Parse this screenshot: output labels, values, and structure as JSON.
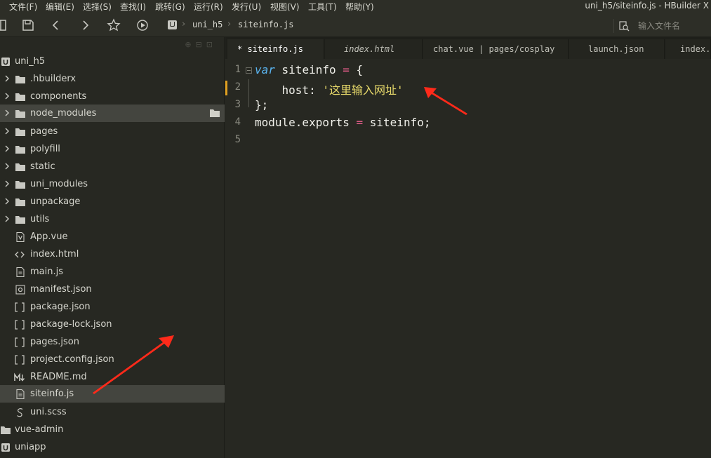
{
  "menu": [
    "文件(F)",
    "编辑(E)",
    "选择(S)",
    "查找(I)",
    "跳转(G)",
    "运行(R)",
    "发行(U)",
    "视图(V)",
    "工具(T)",
    "帮助(Y)"
  ],
  "window_title": "uni_h5/siteinfo.js - HBuilder X",
  "toolbar": {
    "breadcrumb_project": "uni_h5",
    "breadcrumb_file": "siteinfo.js",
    "search_placeholder": "输入文件名"
  },
  "tree": [
    {
      "label": "uni_h5",
      "kind": "project"
    },
    {
      "label": ".hbuilderx",
      "kind": "folder"
    },
    {
      "label": "components",
      "kind": "folder"
    },
    {
      "label": "node_modules",
      "kind": "folder"
    },
    {
      "label": "pages",
      "kind": "folder"
    },
    {
      "label": "polyfill",
      "kind": "folder"
    },
    {
      "label": "static",
      "kind": "folder"
    },
    {
      "label": "uni_modules",
      "kind": "folder"
    },
    {
      "label": "unpackage",
      "kind": "folder"
    },
    {
      "label": "utils",
      "kind": "folder"
    },
    {
      "label": "App.vue",
      "kind": "vue-file"
    },
    {
      "label": "index.html",
      "kind": "html-file"
    },
    {
      "label": "main.js",
      "kind": "js-file"
    },
    {
      "label": "manifest.json",
      "kind": "manifest-file"
    },
    {
      "label": "package.json",
      "kind": "json-file"
    },
    {
      "label": "package-lock.json",
      "kind": "json-file"
    },
    {
      "label": "pages.json",
      "kind": "json-file"
    },
    {
      "label": "project.config.json",
      "kind": "json-file"
    },
    {
      "label": "README.md",
      "kind": "markdown-file"
    },
    {
      "label": "siteinfo.js",
      "kind": "js-file",
      "selected": true
    },
    {
      "label": "uni.scss",
      "kind": "scss-file"
    },
    {
      "label": "vue-admin",
      "kind": "project"
    },
    {
      "label": "uniapp",
      "kind": "project"
    }
  ],
  "tabs": [
    {
      "label": "* siteinfo.js",
      "active": true
    },
    {
      "label": "index.html"
    },
    {
      "label": "chat.vue | pages/cosplay"
    },
    {
      "label": "launch.json"
    },
    {
      "label": "index.v"
    }
  ],
  "code_lines": [
    {
      "num": "1",
      "parts": [
        [
          "kw",
          "var"
        ],
        [
          "plain",
          " siteinfo "
        ],
        [
          "op",
          "="
        ],
        [
          "plain",
          " {"
        ]
      ]
    },
    {
      "num": "2",
      "modified": true,
      "parts": [
        [
          "plain",
          "    host: "
        ],
        [
          "str",
          "'这里输入网址'"
        ]
      ]
    },
    {
      "num": "3",
      "parts": [
        [
          "plain",
          "};"
        ]
      ]
    },
    {
      "num": "4",
      "parts": [
        [
          "plain",
          "module.exports "
        ],
        [
          "op",
          "="
        ],
        [
          "plain",
          " siteinfo;"
        ]
      ]
    },
    {
      "num": "5",
      "parts": []
    }
  ],
  "colors": {
    "background": "#272822",
    "keyword": "#5ab4f0",
    "string": "#e6d86a",
    "operator": "#f06090",
    "annotation_arrow": "#ff2a1a",
    "modified_marker": "#e0a020"
  }
}
